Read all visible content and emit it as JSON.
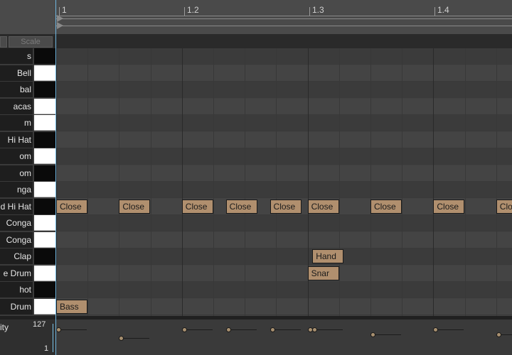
{
  "ruler": {
    "bars": [
      "1",
      "1.2",
      "1.3",
      "1.4"
    ]
  },
  "toolbar": {
    "scale_label": "Scale"
  },
  "keys": [
    {
      "label": "s",
      "color": "black"
    },
    {
      "label": "Bell",
      "color": "white"
    },
    {
      "label": "bal",
      "color": "black"
    },
    {
      "label": "acas",
      "color": "white"
    },
    {
      "label": "m",
      "color": "white"
    },
    {
      "label": "Hi Hat",
      "color": "black"
    },
    {
      "label": "om",
      "color": "white"
    },
    {
      "label": "om",
      "color": "black"
    },
    {
      "label": "nga",
      "color": "white"
    },
    {
      "label": "d Hi Hat",
      "color": "black"
    },
    {
      "label": "Conga",
      "color": "white"
    },
    {
      "label": "Conga",
      "color": "white"
    },
    {
      "label": "Clap",
      "color": "black"
    },
    {
      "label": "e Drum",
      "color": "white"
    },
    {
      "label": "hot",
      "color": "black"
    },
    {
      "label": "Drum",
      "color": "white"
    }
  ],
  "notes": [
    {
      "label": "Close",
      "lane": 9,
      "beat": 0
    },
    {
      "label": "Close",
      "lane": 9,
      "beat": 2
    },
    {
      "label": "Close",
      "lane": 9,
      "beat": 4
    },
    {
      "label": "Close",
      "lane": 9,
      "beat": 5.4
    },
    {
      "label": "Close",
      "lane": 9,
      "beat": 6.8
    },
    {
      "label": "Close",
      "lane": 9,
      "beat": 8
    },
    {
      "label": "Close",
      "lane": 9,
      "beat": 10
    },
    {
      "label": "Close",
      "lane": 9,
      "beat": 12
    },
    {
      "label": "Close",
      "lane": 9,
      "beat": 14
    },
    {
      "label": "Hand",
      "lane": 12,
      "beat": 8.15
    },
    {
      "label": "Snar",
      "lane": 13,
      "beat": 8
    },
    {
      "label": "Bass",
      "lane": 15,
      "beat": 0
    }
  ],
  "velocity": {
    "label": "ity",
    "max_label": "127",
    "min_label": "1",
    "dots": [
      {
        "beat": 0,
        "value": 0.9
      },
      {
        "beat": 2,
        "value": 0.55
      },
      {
        "beat": 4,
        "value": 0.9
      },
      {
        "beat": 5.4,
        "value": 0.9
      },
      {
        "beat": 6.8,
        "value": 0.9
      },
      {
        "beat": 8,
        "value": 0.9
      },
      {
        "beat": 8.15,
        "value": 0.9
      },
      {
        "beat": 10,
        "value": 0.7
      },
      {
        "beat": 12,
        "value": 0.9
      },
      {
        "beat": 14,
        "value": 0.7
      }
    ]
  },
  "colors": {
    "note_fill": "#b08f6e",
    "playhead": "#6fb6e0"
  }
}
